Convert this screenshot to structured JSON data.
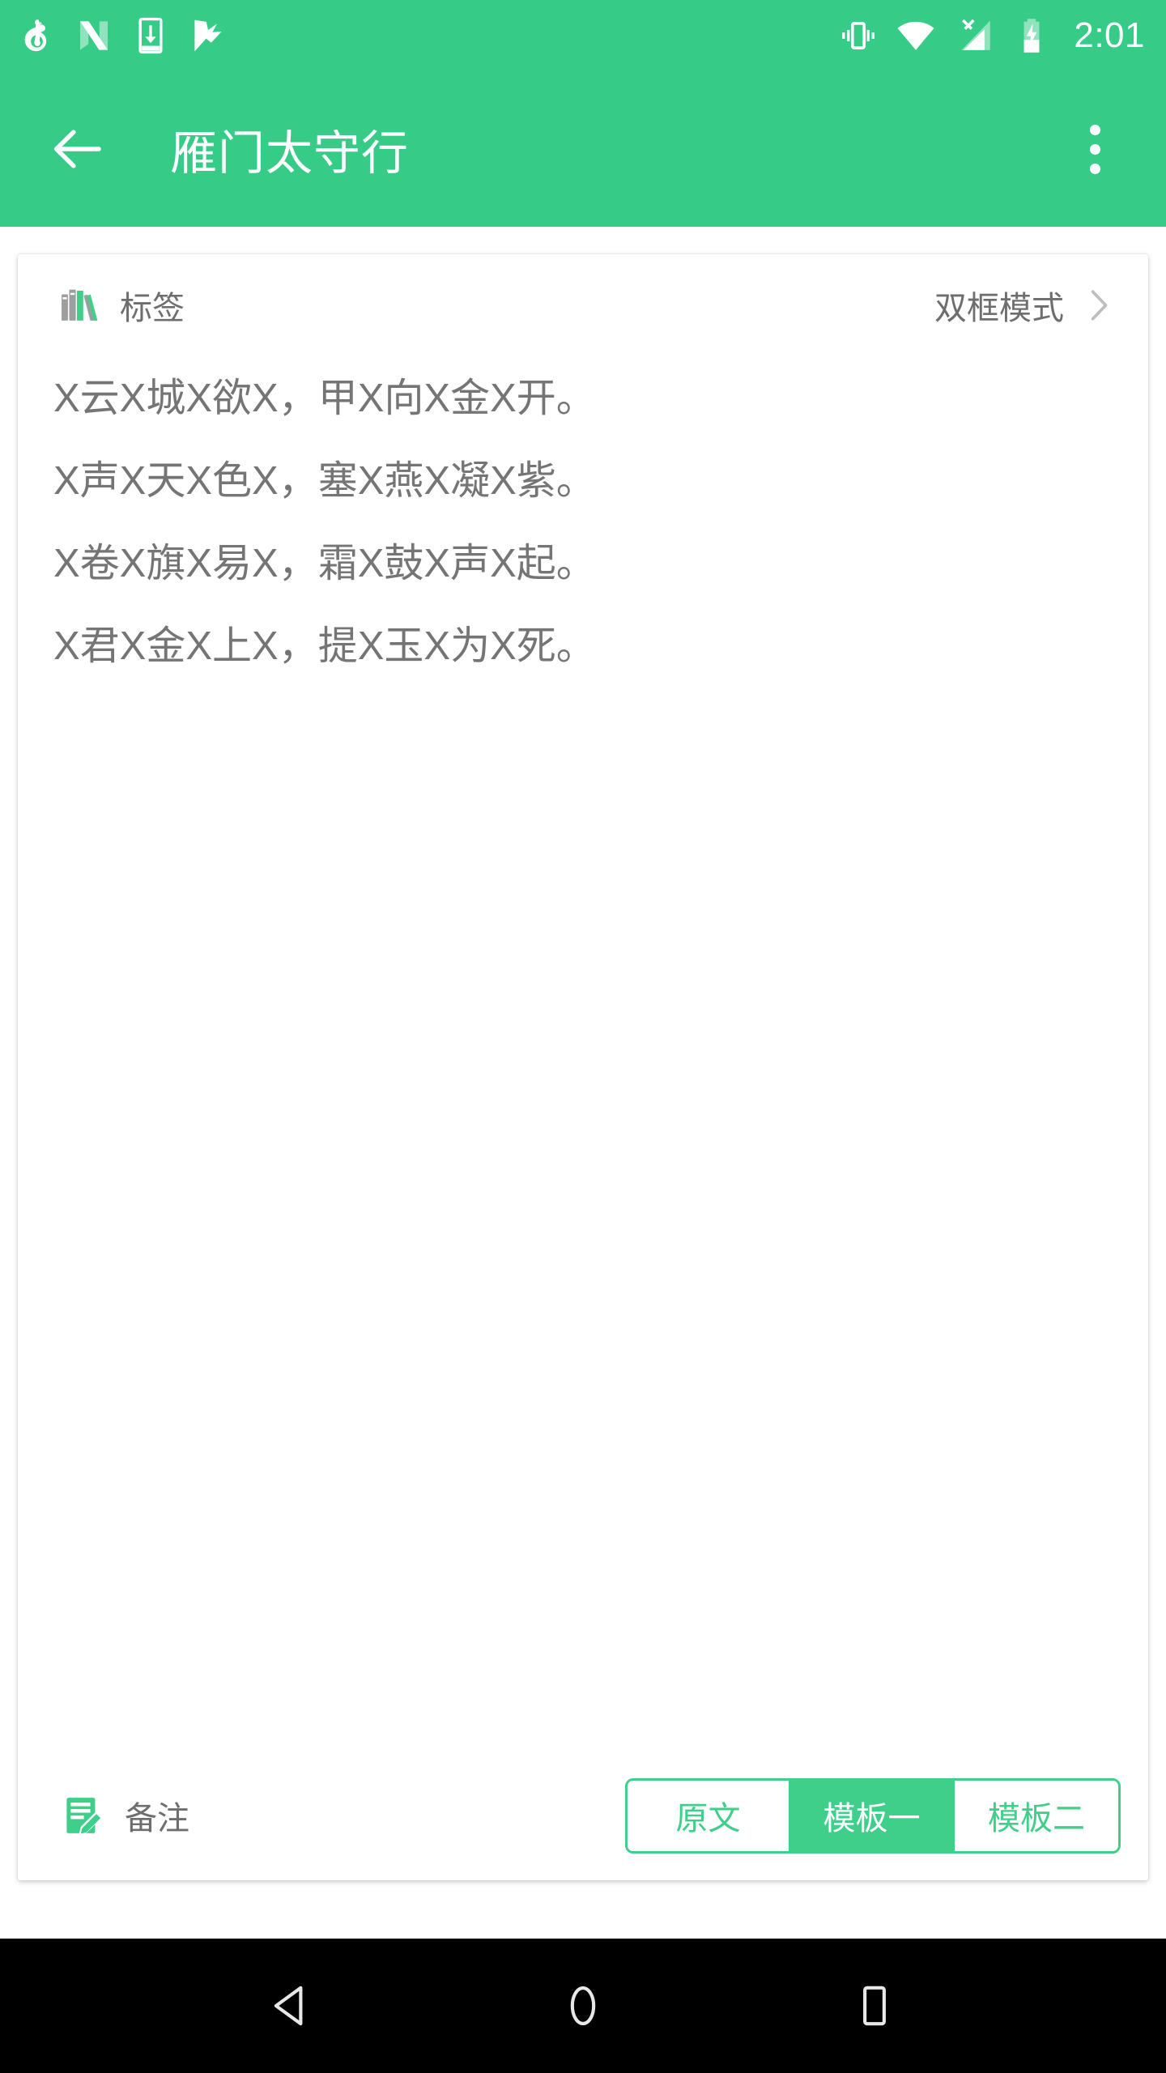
{
  "status_bar": {
    "background_color": "#36CC87",
    "time": "2:01",
    "left_icons": [
      {
        "name": "netease-music-icon"
      },
      {
        "name": "android-nougat-icon"
      },
      {
        "name": "download-to-phone-icon"
      },
      {
        "name": "checkmark-flag-icon"
      }
    ],
    "right_icons": [
      {
        "name": "vibrate-mode-icon"
      },
      {
        "name": "wifi-icon"
      },
      {
        "name": "no-sim-signal-icon"
      },
      {
        "name": "battery-charging-icon"
      }
    ]
  },
  "app_bar": {
    "background_color": "#36CC87",
    "back_label": "back",
    "title": "雁门太守行",
    "overflow_label": "more options"
  },
  "card": {
    "header": {
      "tag_icon": "books-icon",
      "tag_label": "标签",
      "mode_label": "双框模式",
      "chevron_icon": "chevron-right-icon"
    },
    "poem_lines": [
      "X云X城X欲X，甲X向X金X开。",
      "X声X天X色X，塞X燕X凝X紫。",
      "X卷X旗X易X，霜X鼓X声X起。",
      "X君X金X上X，提X玉X为X死。"
    ],
    "footer": {
      "notes_icon": "note-edit-icon",
      "notes_label": "备注",
      "segments": [
        {
          "label": "原文",
          "active": false
        },
        {
          "label": "模板一",
          "active": true
        },
        {
          "label": "模板二",
          "active": false
        }
      ],
      "accent_color": "#3FCF8A"
    }
  },
  "nav_bar": {
    "background_color": "#000000",
    "buttons": [
      {
        "name": "nav-back-button",
        "icon": "triangle-left-icon"
      },
      {
        "name": "nav-home-button",
        "icon": "circle-icon"
      },
      {
        "name": "nav-recents-button",
        "icon": "square-icon"
      }
    ]
  }
}
